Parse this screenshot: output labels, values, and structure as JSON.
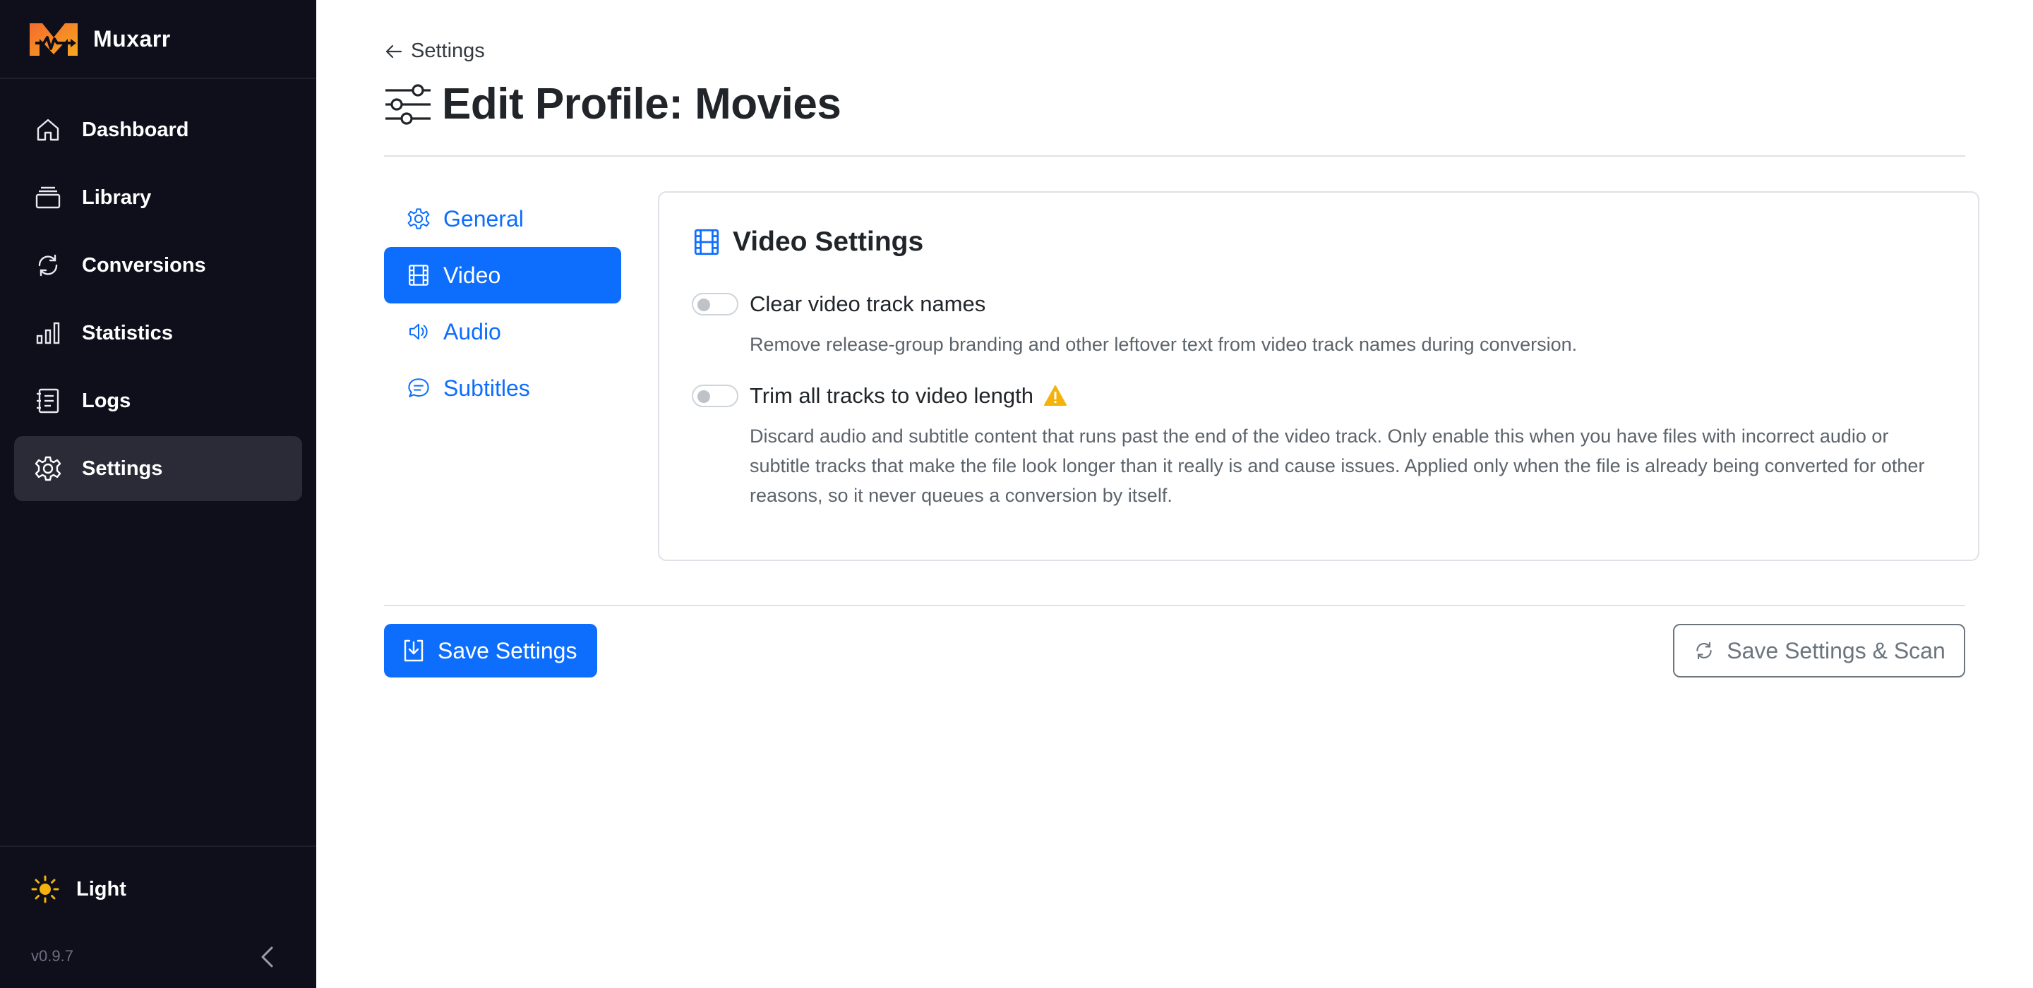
{
  "app": {
    "name": "Muxarr",
    "version": "v0.9.7"
  },
  "sidebar": {
    "items": [
      {
        "label": "Dashboard",
        "icon": "house-icon"
      },
      {
        "label": "Library",
        "icon": "collection-icon"
      },
      {
        "label": "Conversions",
        "icon": "arrow-repeat-icon"
      },
      {
        "label": "Statistics",
        "icon": "bar-chart-icon"
      },
      {
        "label": "Logs",
        "icon": "journal-icon"
      },
      {
        "label": "Settings",
        "icon": "gear-icon",
        "active": true
      }
    ],
    "theme_label": "Light"
  },
  "header": {
    "back_label": "Settings",
    "title": "Edit Profile: Movies"
  },
  "tabs": [
    {
      "label": "General",
      "icon": "gear-icon"
    },
    {
      "label": "Video",
      "icon": "film-icon",
      "active": true
    },
    {
      "label": "Audio",
      "icon": "volume-icon"
    },
    {
      "label": "Subtitles",
      "icon": "chat-text-icon"
    }
  ],
  "card": {
    "title": "Video Settings",
    "settings": [
      {
        "label": "Clear video track names",
        "enabled": false,
        "description": "Remove release-group branding and other leftover text from video track names during conversion."
      },
      {
        "label": "Trim all tracks to video length",
        "enabled": false,
        "warning": true,
        "description": "Discard audio and subtitle content that runs past the end of the video track. Only enable this when you have files with incorrect audio or subtitle tracks that make the file look longer than it really is and cause issues. Applied only when the file is already being converted for other reasons, so it never queues a conversion by itself."
      }
    ]
  },
  "actions": {
    "save_label": "Save Settings",
    "save_scan_label": "Save Settings & Scan"
  },
  "colors": {
    "primary": "#0d6efd",
    "sidebar_bg": "#0f0f1c",
    "warning": "#f5b20a",
    "brand_orange": "#f7931e"
  }
}
